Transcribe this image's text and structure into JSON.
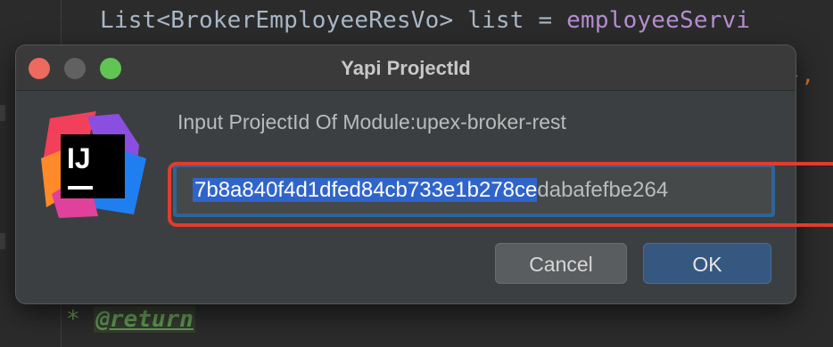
{
  "editor": {
    "code_top_prefix": "List<BrokerEmployeeResVo> list = ",
    "code_top_method": "employeeServi",
    "code_right": "-,",
    "code_bottom_star": "* ",
    "code_bottom_tag": "@return"
  },
  "dialog": {
    "title": "Yapi ProjectId",
    "prompt": "Input ProjectId Of Module:upex-broker-rest",
    "input_selected": "7b8a840f4d1dfed84cb733e1b278ce",
    "input_rest": "dabafefbe264",
    "cancel_label": "Cancel",
    "ok_label": "OK",
    "logo_text": "IJ"
  },
  "colors": {
    "accent": "#2f65ca",
    "annotation": "#e53a2f"
  }
}
